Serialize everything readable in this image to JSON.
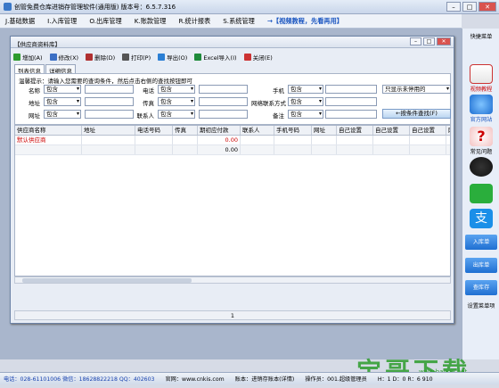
{
  "app": {
    "title": "创管免费仓库进销存管理软件(通用版) 版本号：6.5.7.316"
  },
  "menu": [
    "J.基础数据",
    "I.入库管理",
    "O.出库管理",
    "K.账款管理",
    "R.统计报表",
    "S.系统管理"
  ],
  "video_link": "→【视频教程，先看再用】",
  "dialog": {
    "title": "【供应商资料库】",
    "toolbar": [
      {
        "label": "增加(A)",
        "color": "#2e9b2e",
        "name": "add-button",
        "icon": "plus-icon"
      },
      {
        "label": "修改(X)",
        "color": "#3b6fc4",
        "name": "edit-button",
        "icon": "pencil-icon"
      },
      {
        "label": "删除(D)",
        "color": "#b03030",
        "name": "delete-button",
        "icon": "minus-icon"
      },
      {
        "label": "打印(P)",
        "color": "#555555",
        "name": "print-button",
        "icon": "printer-icon"
      },
      {
        "label": "导出(O)",
        "color": "#2b7fd4",
        "name": "export-button",
        "icon": "globe-icon"
      },
      {
        "label": "Excel导入(I)",
        "color": "#1e8a3a",
        "name": "excel-import-button",
        "icon": "excel-icon"
      },
      {
        "label": "关闭(E)",
        "color": "#cc3333",
        "name": "close-button",
        "icon": "close-icon"
      }
    ],
    "tabs": [
      "列表信息",
      "详细信息"
    ],
    "hint": "温馨提示：请输入您需要的查询条件，然后点击右侧的查找按钮即可",
    "fields": {
      "name": "名称",
      "phone": "电话",
      "mobile": "手机",
      "address": "地址",
      "fax": "传真",
      "contact_method": "网络联系方式",
      "url": "网址",
      "contact": "联系人",
      "remark": "备注"
    },
    "select_value": "包含",
    "only_disabled": "只显示未停用的",
    "find_button": "←按条件查找(F)",
    "columns": [
      "供应商名称",
      "地址",
      "电话号码",
      "传真",
      "期初应付款",
      "联系人",
      "手机号码",
      "网址",
      "自己设置",
      "自己设置",
      "自己设置",
      "网"
    ],
    "rows": [
      {
        "name": "默认供应商",
        "amount": "0.00"
      },
      {
        "name": "",
        "amount": "0.00"
      }
    ],
    "page": "1"
  },
  "sidebar": {
    "title": "快捷菜单",
    "items": [
      "视频教程",
      "官方网站",
      "常见问题"
    ],
    "buttons": [
      "入库单",
      "出库单",
      "查库存"
    ],
    "settings": "设置菜单项"
  },
  "status": {
    "phone": "电话：028-61101006 微信：18628822218 QQ：402603",
    "site": "官网：www.cnkis.com",
    "account": "账本：进销存账本(详情)",
    "operator": "操作员：001.超级管理员",
    "time": "H：1 D：0 R：6 910"
  },
  "watermark": {
    "text": "宝哥下载",
    "url": "www.baoge.net"
  }
}
